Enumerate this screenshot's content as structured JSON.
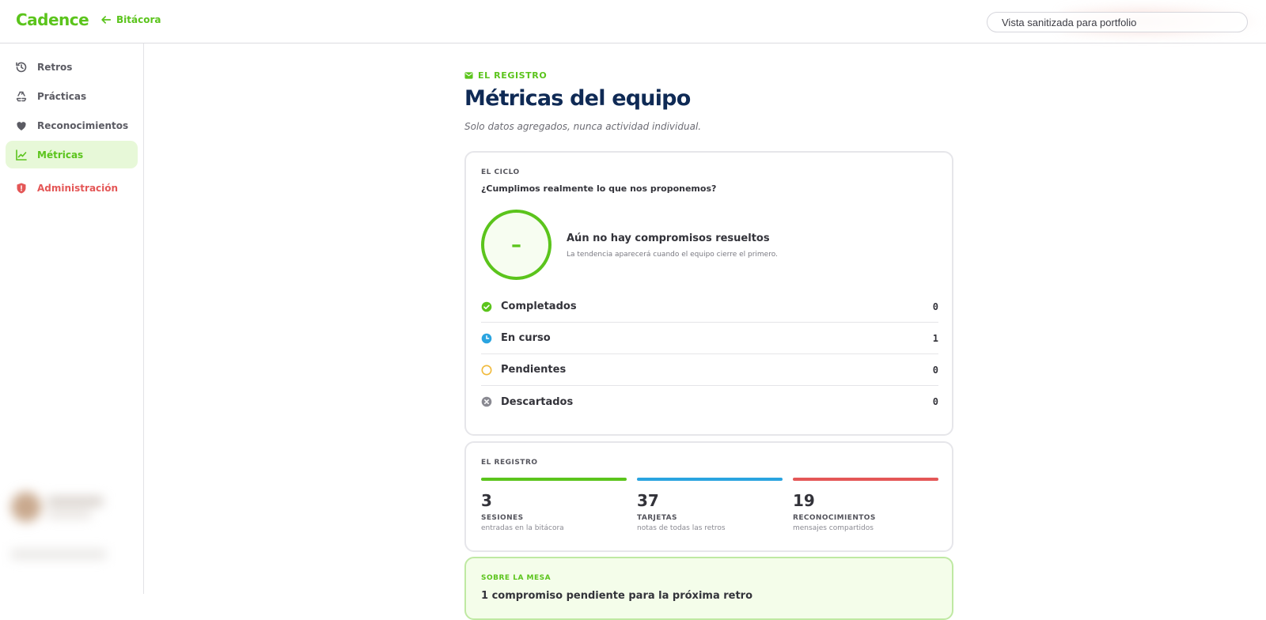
{
  "header": {
    "logo": "Cadence",
    "back_label": "Bitácora",
    "search_text": "Vista sanitizada para portfolio"
  },
  "sidebar": {
    "items": [
      {
        "label": "Retros",
        "icon": "history-icon"
      },
      {
        "label": "Prácticas",
        "icon": "recycle-icon"
      },
      {
        "label": "Reconocimientos",
        "icon": "heart-icon"
      },
      {
        "label": "Métricas",
        "icon": "chart-line-icon",
        "active": true
      },
      {
        "label": "Administración",
        "icon": "shield-icon",
        "danger": true
      }
    ]
  },
  "page": {
    "eyebrow": "EL REGISTRO",
    "title": "Métricas del equipo",
    "subtitle": "Solo datos agregados, nunca actividad individual."
  },
  "cycle": {
    "label": "EL CICLO",
    "question": "¿Cumplimos realmente lo que nos proponemos?",
    "ring_value": "–",
    "empty_title": "Aún no hay compromisos resueltos",
    "empty_subtitle": "La tendencia aparecerá cuando el equipo cierre el primero.",
    "statuses": [
      {
        "label": "Completados",
        "count": "0",
        "color": "#5bc41c"
      },
      {
        "label": "En curso",
        "count": "1",
        "color": "#2aa4e0"
      },
      {
        "label": "Pendientes",
        "count": "0",
        "color": "#f0b93a"
      },
      {
        "label": "Descartados",
        "count": "0",
        "color": "#8a8a92"
      }
    ]
  },
  "register": {
    "label": "EL REGISTRO",
    "stats": [
      {
        "value": "3",
        "label": "SESIONES",
        "desc": "entradas en la bitácora",
        "color": "#5bc41c"
      },
      {
        "value": "37",
        "label": "TARJETAS",
        "desc": "notas de todas las retros",
        "color": "#2aa4e0"
      },
      {
        "value": "19",
        "label": "RECONOCIMIENTOS",
        "desc": "mensajes compartidos",
        "color": "#e45757"
      }
    ]
  },
  "table_section": {
    "label": "SOBRE LA MESA",
    "text": "1 compromiso pendiente para la próxima retro"
  },
  "colors": {
    "accent": "#5bc41c",
    "title": "#0f2a55",
    "danger": "#e45757"
  }
}
